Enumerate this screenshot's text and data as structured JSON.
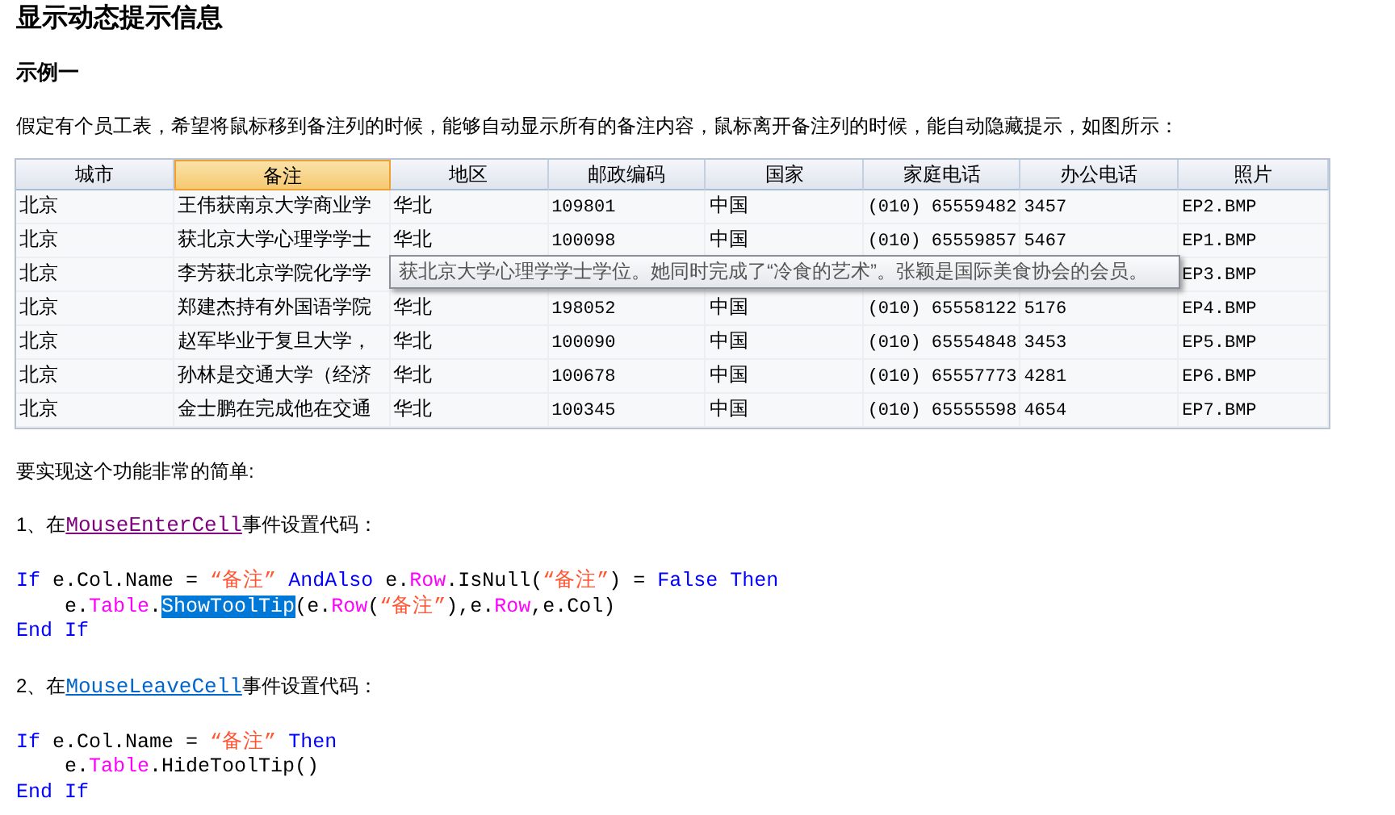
{
  "title": "显示动态提示信息",
  "subtitle": "示例一",
  "intro": "假定有个员工表，希望将鼠标移到备注列的时候，能够自动显示所有的备注内容，鼠标离开备注列的时候，能自动隐藏提示，如图所示：",
  "table": {
    "columns": [
      {
        "label": "城市",
        "selected": false
      },
      {
        "label": "备注",
        "selected": true
      },
      {
        "label": "地区",
        "selected": false
      },
      {
        "label": "邮政编码",
        "selected": false
      },
      {
        "label": "国家",
        "selected": false
      },
      {
        "label": "家庭电话",
        "selected": false
      },
      {
        "label": "办公电话",
        "selected": false
      },
      {
        "label": "照片",
        "selected": false
      }
    ],
    "rows": [
      {
        "city": "北京",
        "note": "王伟获南京大学商业学",
        "region": "华北",
        "zip": "109801",
        "country": "中国",
        "home_phone": "(010) 65559482",
        "office_phone": "3457",
        "photo": "EP2.BMP"
      },
      {
        "city": "北京",
        "note": "获北京大学心理学学士",
        "region": "华北",
        "zip": "100098",
        "country": "中国",
        "home_phone": "(010) 65559857",
        "office_phone": "5467",
        "photo": "EP1.BMP"
      },
      {
        "city": "北京",
        "note": "李芳获北京学院化学学",
        "photo": "EP3.BMP"
      },
      {
        "city": "北京",
        "note": "郑建杰持有外国语学院",
        "region": "华北",
        "zip": "198052",
        "country": "中国",
        "home_phone": "(010) 65558122",
        "office_phone": "5176",
        "photo": "EP4.BMP"
      },
      {
        "city": "北京",
        "note": "赵军毕业于复旦大学，",
        "region": "华北",
        "zip": "100090",
        "country": "中国",
        "home_phone": "(010) 65554848",
        "office_phone": "3453",
        "photo": "EP5.BMP"
      },
      {
        "city": "北京",
        "note": "孙林是交通大学（经济",
        "region": "华北",
        "zip": "100678",
        "country": "中国",
        "home_phone": "(010) 65557773",
        "office_phone": "4281",
        "photo": "EP6.BMP"
      },
      {
        "city": "北京",
        "note": "金士鹏在完成他在交通",
        "region": "华北",
        "zip": "100345",
        "country": "中国",
        "home_phone": "(010) 65555598",
        "office_phone": "4654",
        "photo": "EP7.BMP"
      }
    ],
    "tooltip": "获北京大学心理学学士学位。她同时完成了“冷食的艺术”。张颖是国际美食协会的会员。"
  },
  "summary": "要实现这个功能非常的简单:",
  "steps": [
    {
      "prefix": "1、在",
      "link": {
        "text": "MouseEnterCell",
        "visited": true
      },
      "suffix": "事件设置代码：",
      "code": [
        [
          {
            "kind": "keyword",
            "text": "If"
          },
          {
            "kind": "plain",
            "text": " e.Col.Name = "
          },
          {
            "kind": "string",
            "text": "“备注”"
          },
          {
            "kind": "keyword",
            "text": " AndAlso"
          },
          {
            "kind": "plain",
            "text": " e."
          },
          {
            "kind": "member",
            "text": "Row"
          },
          {
            "kind": "plain",
            "text": ".IsNull("
          },
          {
            "kind": "string",
            "text": "“备注”"
          },
          {
            "kind": "plain",
            "text": ") = "
          },
          {
            "kind": "keyword",
            "text": "False Then"
          }
        ],
        [
          {
            "kind": "plain",
            "text": "    e."
          },
          {
            "kind": "member",
            "text": "Table"
          },
          {
            "kind": "plain",
            "text": "."
          },
          {
            "kind": "selected",
            "text": "ShowToolTip"
          },
          {
            "kind": "plain",
            "text": "(e."
          },
          {
            "kind": "member",
            "text": "Row"
          },
          {
            "kind": "plain",
            "text": "("
          },
          {
            "kind": "string",
            "text": "“备注”"
          },
          {
            "kind": "plain",
            "text": "),e."
          },
          {
            "kind": "member",
            "text": "Row"
          },
          {
            "kind": "plain",
            "text": ",e.Col)"
          }
        ],
        [
          {
            "kind": "keyword",
            "text": "End If"
          }
        ]
      ]
    },
    {
      "prefix": "2、在",
      "link": {
        "text": "MouseLeaveCell",
        "visited": false
      },
      "suffix": "事件设置代码：",
      "code": [
        [
          {
            "kind": "keyword",
            "text": "If"
          },
          {
            "kind": "plain",
            "text": " e.Col.Name = "
          },
          {
            "kind": "string",
            "text": "“备注”"
          },
          {
            "kind": "keyword",
            "text": " Then"
          }
        ],
        [
          {
            "kind": "plain",
            "text": "    e."
          },
          {
            "kind": "member",
            "text": "Table"
          },
          {
            "kind": "plain",
            "text": ".HideToolTip()"
          }
        ],
        [
          {
            "kind": "keyword",
            "text": "End If"
          }
        ]
      ]
    }
  ]
}
